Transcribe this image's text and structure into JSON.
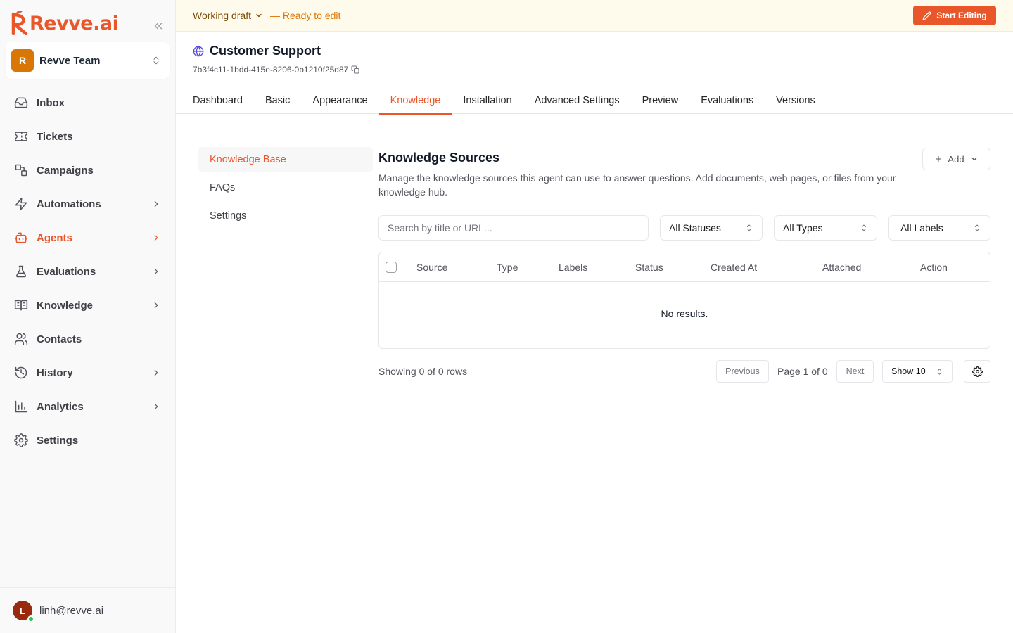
{
  "brand": {
    "name": "Revve.ai",
    "accent": "#e8562a"
  },
  "sidebar": {
    "team": {
      "initial": "R",
      "name": "Revve Team"
    },
    "items": [
      {
        "label": "Inbox",
        "icon": "inbox-icon",
        "has_chevron": false,
        "active": false
      },
      {
        "label": "Tickets",
        "icon": "ticket-icon",
        "has_chevron": false,
        "active": false
      },
      {
        "label": "Campaigns",
        "icon": "campaign-icon",
        "has_chevron": false,
        "active": false
      },
      {
        "label": "Automations",
        "icon": "bolt-icon",
        "has_chevron": true,
        "active": false
      },
      {
        "label": "Agents",
        "icon": "bot-icon",
        "has_chevron": true,
        "active": true
      },
      {
        "label": "Evaluations",
        "icon": "flask-icon",
        "has_chevron": true,
        "active": false
      },
      {
        "label": "Knowledge",
        "icon": "book-icon",
        "has_chevron": true,
        "active": false
      },
      {
        "label": "Contacts",
        "icon": "users-icon",
        "has_chevron": false,
        "active": false
      },
      {
        "label": "History",
        "icon": "history-icon",
        "has_chevron": true,
        "active": false
      },
      {
        "label": "Analytics",
        "icon": "chart-icon",
        "has_chevron": true,
        "active": false
      },
      {
        "label": "Settings",
        "icon": "gear-icon",
        "has_chevron": false,
        "active": false
      }
    ],
    "user": {
      "initial": "L",
      "email": "linh@revve.ai"
    }
  },
  "banner": {
    "draft_label": "Working draft",
    "status_text": "— Ready to edit",
    "start_button": "Start Editing"
  },
  "header": {
    "title": "Customer Support",
    "agent_id": "7b3f4c11-1bdd-415e-8206-0b1210f25d87"
  },
  "tabs": [
    {
      "label": "Dashboard",
      "active": false
    },
    {
      "label": "Basic",
      "active": false
    },
    {
      "label": "Appearance",
      "active": false
    },
    {
      "label": "Knowledge",
      "active": true
    },
    {
      "label": "Installation",
      "active": false
    },
    {
      "label": "Advanced Settings",
      "active": false
    },
    {
      "label": "Preview",
      "active": false
    },
    {
      "label": "Evaluations",
      "active": false
    },
    {
      "label": "Versions",
      "active": false
    }
  ],
  "subnav": [
    {
      "label": "Knowledge Base",
      "active": true
    },
    {
      "label": "FAQs",
      "active": false
    },
    {
      "label": "Settings",
      "active": false
    }
  ],
  "main": {
    "title": "Knowledge Sources",
    "description": "Manage the knowledge sources this agent can use to answer questions. Add documents, web pages, or files from your knowledge hub.",
    "add_button": "Add",
    "search": {
      "placeholder": "Search by title or URL...",
      "value": ""
    },
    "filters": {
      "status": "All Statuses",
      "type": "All Types",
      "labels": "All Labels"
    },
    "table": {
      "columns": [
        "Source",
        "Type",
        "Labels",
        "Status",
        "Created At",
        "Attached",
        "Action"
      ],
      "rows": [],
      "empty_text": "No results."
    },
    "pagination": {
      "showing": "Showing 0 of 0 rows",
      "previous": "Previous",
      "page_info": "Page 1 of 0",
      "next": "Next",
      "page_size": "Show 10"
    }
  }
}
